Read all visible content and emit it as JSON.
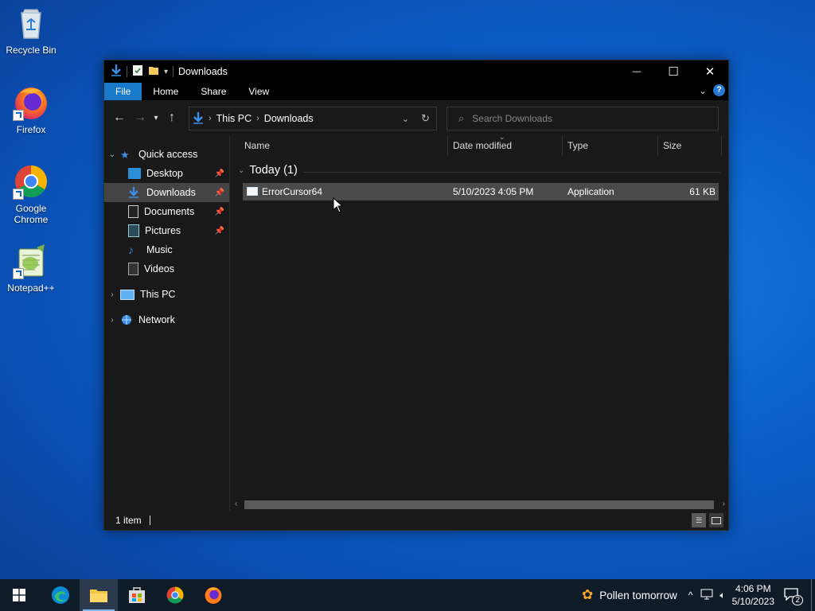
{
  "desktop": {
    "icons": [
      {
        "label": "Recycle Bin",
        "icon": "recycle-bin-icon"
      },
      {
        "label": "Firefox",
        "icon": "firefox-icon"
      },
      {
        "label": "Google Chrome",
        "icon": "chrome-icon"
      },
      {
        "label": "Notepad++",
        "icon": "notepad-plus-plus-icon"
      }
    ]
  },
  "window": {
    "title": "Downloads",
    "controls": {
      "minimize": "—",
      "maximize": "☐",
      "close": "✕"
    },
    "ribbon": {
      "tabs": [
        "File",
        "Home",
        "Share",
        "View"
      ],
      "help": "?"
    },
    "address": {
      "segments": [
        "This PC",
        "Downloads"
      ]
    },
    "search": {
      "placeholder": "Search Downloads"
    },
    "nav_pane": {
      "quick_access": "Quick access",
      "items": [
        {
          "label": "Desktop",
          "pinned": true
        },
        {
          "label": "Downloads",
          "pinned": true,
          "selected": true
        },
        {
          "label": "Documents",
          "pinned": true
        },
        {
          "label": "Pictures",
          "pinned": true
        },
        {
          "label": "Music",
          "pinned": false
        },
        {
          "label": "Videos",
          "pinned": false
        }
      ],
      "this_pc": "This PC",
      "network": "Network"
    },
    "columns": [
      "Name",
      "Date modified",
      "Type",
      "Size"
    ],
    "group": "Today (1)",
    "files": [
      {
        "name": "ErrorCursor64",
        "date_modified": "5/10/2023 4:05 PM",
        "type": "Application",
        "size": "61 KB"
      }
    ],
    "status": "1 item"
  },
  "taskbar": {
    "apps": [
      "start-icon",
      "edge-icon",
      "file-explorer-icon",
      "store-icon",
      "chrome-icon",
      "firefox-icon"
    ],
    "weather": "Pollen tomorrow",
    "time": "4:06 PM",
    "date": "5/10/2023",
    "notification_count": "2"
  },
  "colors": {
    "accent": "#1979ca",
    "window_bg": "#191919",
    "selection": "#4a4a4a",
    "taskbar": "#101b28"
  }
}
